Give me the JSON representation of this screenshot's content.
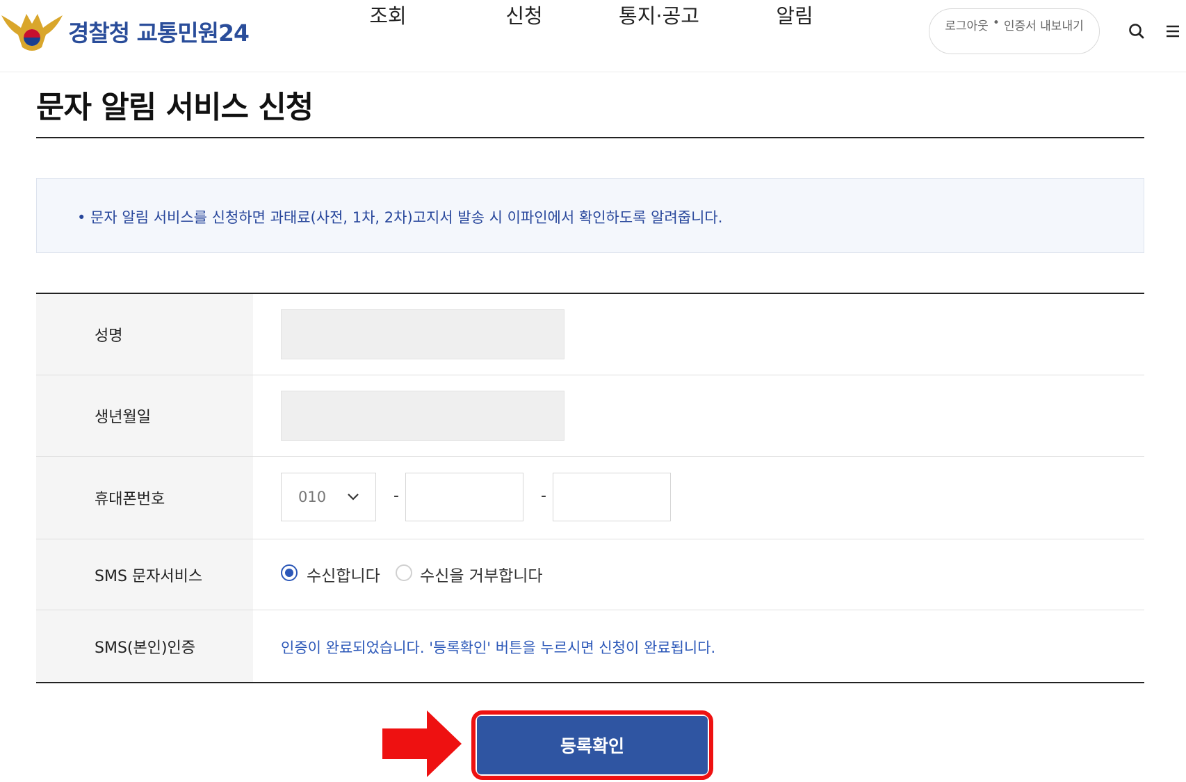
{
  "header": {
    "logo_text": "경찰청 교통민원24",
    "nav": [
      {
        "label": "조회"
      },
      {
        "label": "신청"
      },
      {
        "label": "통지·공고"
      },
      {
        "label": "알림"
      }
    ],
    "account": {
      "logout": "로그아웃",
      "separator": "•",
      "export_cert": "인증서 내보내기"
    },
    "icons": [
      "search-icon",
      "menu-icon"
    ]
  },
  "page": {
    "title": "문자 알림 서비스 신청",
    "notice": "• 문자 알림 서비스를 신청하면 과태료(사전, 1차, 2차)고지서 발송 시 이파인에서 확인하도록 알려줍니다."
  },
  "form": {
    "name": {
      "label": "성명",
      "value": ""
    },
    "birthdate": {
      "label": "생년월일",
      "value": ""
    },
    "phone": {
      "label": "휴대폰번호",
      "prefix": "010",
      "separator": "-",
      "middle": "",
      "last": ""
    },
    "sms_service": {
      "label": "SMS 문자서비스",
      "options": [
        {
          "label": "수신합니다",
          "selected": true
        },
        {
          "label": "수신을 거부합니다",
          "selected": false
        }
      ]
    },
    "sms_auth": {
      "label": "SMS(본인)인증",
      "message": "인증이 완료되었습니다. '등록확인' 버튼을 누르시면 신청이 완료됩니다."
    }
  },
  "actions": {
    "submit_label": "등록확인"
  },
  "colors": {
    "brand": "#2a4d9a",
    "button": "#2f55a2",
    "highlight": "#ee1111",
    "notice_text": "#27469b"
  }
}
